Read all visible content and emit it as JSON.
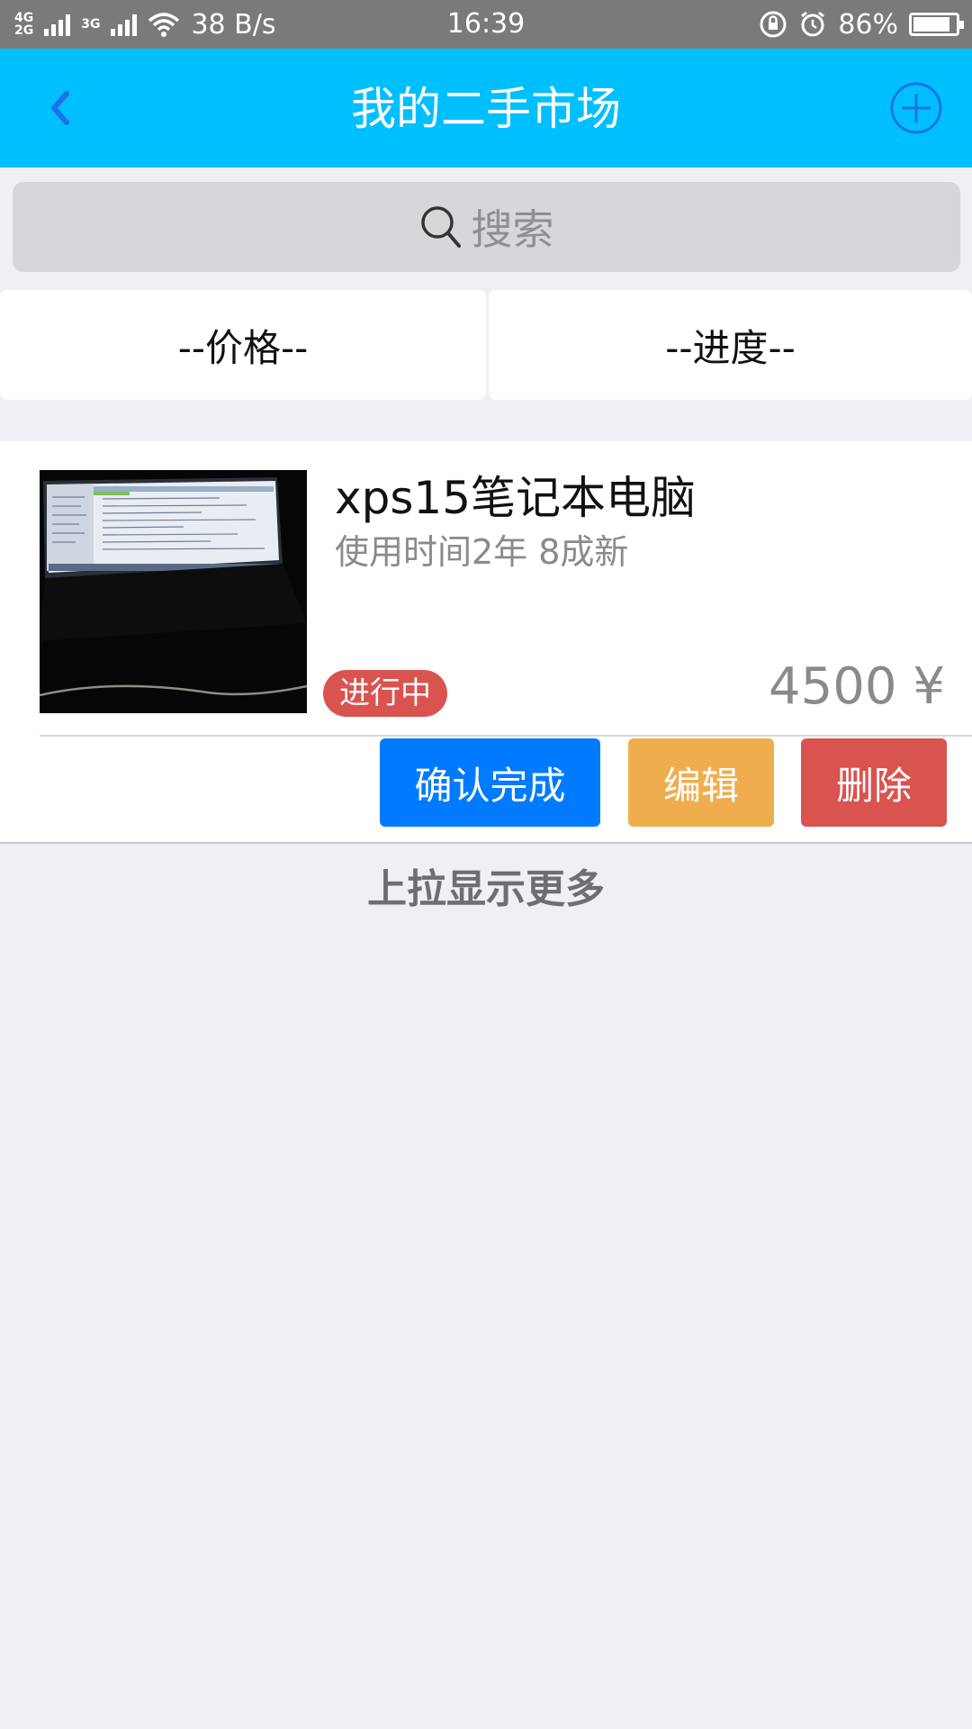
{
  "status_bar": {
    "network_left": "4G",
    "network_left_2": "2G",
    "network_right": "3G",
    "speed": "38 B/s",
    "time": "16:39",
    "battery_text": "86%",
    "battery_level": 0.86
  },
  "header": {
    "title": "我的二手市场",
    "back_icon": "chevron-left-icon",
    "add_icon": "plus-circle-icon"
  },
  "search": {
    "placeholder": "搜索",
    "icon": "search-icon"
  },
  "filters": [
    {
      "label": "--价格--"
    },
    {
      "label": "--进度--"
    }
  ],
  "items": [
    {
      "title": "xps15笔记本电脑",
      "description": "使用时间2年 8成新",
      "status": "进行中",
      "price": "4500 ¥",
      "actions": {
        "confirm": "确认完成",
        "edit": "编辑",
        "delete": "删除"
      }
    }
  ],
  "footer": {
    "load_more": "上拉显示更多"
  },
  "colors": {
    "header_bg": "#00bfff",
    "confirm": "#007aff",
    "edit": "#f0ad4e",
    "delete": "#d9534f",
    "status_badge": "#d9534f"
  }
}
